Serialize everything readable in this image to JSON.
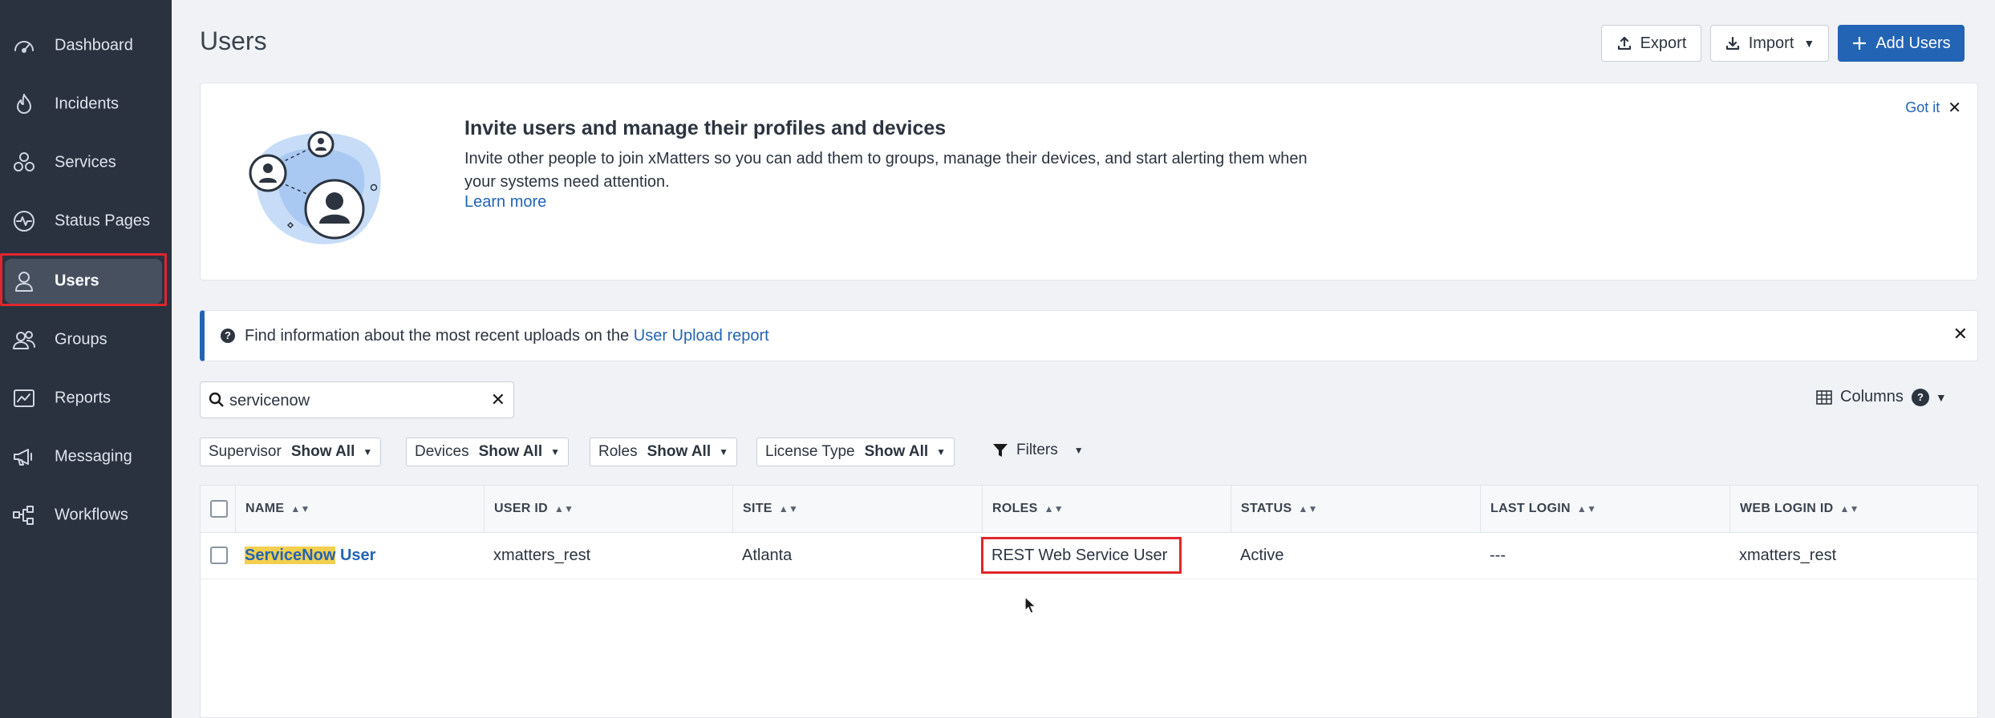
{
  "sidebar": {
    "items": [
      {
        "label": "Dashboard",
        "icon": "gauge-icon",
        "active": false
      },
      {
        "label": "Incidents",
        "icon": "flame-icon",
        "active": false
      },
      {
        "label": "Services",
        "icon": "services-icon",
        "active": false
      },
      {
        "label": "Status Pages",
        "icon": "pulse-icon",
        "active": false
      },
      {
        "label": "Users",
        "icon": "user-icon",
        "active": true
      },
      {
        "label": "Groups",
        "icon": "group-icon",
        "active": false
      },
      {
        "label": "Reports",
        "icon": "chart-icon",
        "active": false
      },
      {
        "label": "Messaging",
        "icon": "megaphone-icon",
        "active": false
      },
      {
        "label": "Workflows",
        "icon": "workflow-icon",
        "active": false
      }
    ]
  },
  "header": {
    "title": "Users",
    "export_label": "Export",
    "import_label": "Import",
    "add_users_label": "Add Users"
  },
  "invite": {
    "title": "Invite users and manage their profiles and devices",
    "text": "Invite other people to join xMatters so you can add them to groups, manage their devices, and start alerting them when your systems need attention.",
    "link": "Learn more",
    "got_it": "Got it"
  },
  "banner": {
    "text": "Find information about the most recent uploads on the",
    "link": "User Upload report"
  },
  "search": {
    "value": "servicenow",
    "placeholder": "Search"
  },
  "columns_label": "Columns",
  "columns_badge": "?",
  "filters": [
    {
      "label": "Supervisor",
      "value": "Show All"
    },
    {
      "label": "Devices",
      "value": "Show All"
    },
    {
      "label": "Roles",
      "value": "Show All"
    },
    {
      "label": "License Type",
      "value": "Show All"
    }
  ],
  "filters_label": "Filters",
  "table": {
    "columns": [
      "NAME",
      "USER ID",
      "SITE",
      "ROLES",
      "STATUS",
      "LAST LOGIN",
      "WEB LOGIN ID"
    ],
    "rows": [
      {
        "name_highlight": "ServiceNow",
        "name_rest": " User",
        "user_id": "xmatters_rest",
        "site": "Atlanta",
        "roles": "REST Web Service User",
        "status": "Active",
        "last_login": "---",
        "web_login_id": "xmatters_rest"
      }
    ]
  },
  "colors": {
    "sidebar_bg": "#2a3240",
    "accent": "#2364b4",
    "highlight_red": "#e0262d",
    "search_highlight": "#f3cf4e"
  }
}
